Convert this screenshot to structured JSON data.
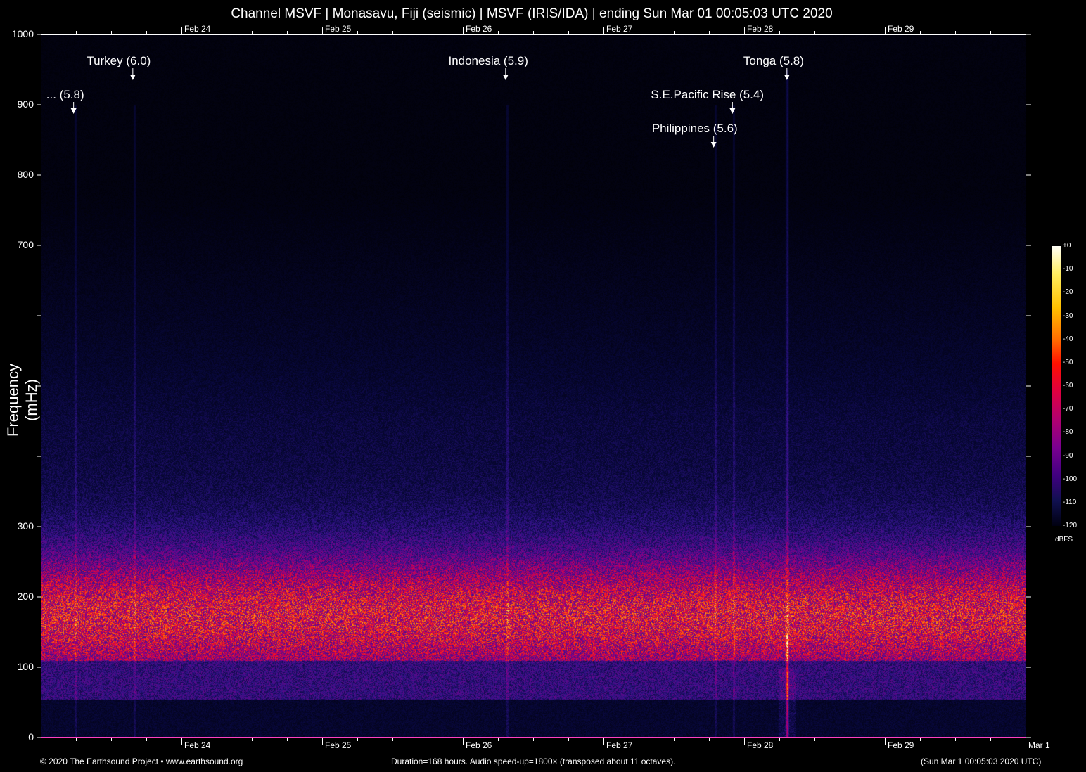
{
  "title": "Channel MSVF | Monasavu, Fiji (seismic) | MSVF (IRIS/IDA) | ending Sun Mar 01 00:05:03 UTC 2020",
  "chart_data": {
    "type": "heatmap",
    "title": "Channel MSVF | Monasavu, Fiji (seismic) | MSVF (IRIS/IDA) | ending Sun Mar 01 00:05:03 UTC 2020",
    "ylabel": "Frequency (mHz)",
    "ylim": [
      0,
      1000
    ],
    "y_ticks": [
      0,
      100,
      200,
      300,
      400,
      500,
      600,
      700,
      800,
      900,
      1000
    ],
    "y_tick_labels": [
      "0",
      "100",
      "200",
      "300",
      "",
      "",
      "",
      "700",
      "800",
      "900",
      "1000"
    ],
    "x_duration_hours": 168,
    "x_tick_labels": [
      "Feb 24",
      "Feb 25",
      "Feb 26",
      "Feb 27",
      "Feb 28",
      "Feb 29",
      "Mar  1"
    ],
    "x_tick_hours": [
      24,
      48,
      72,
      96,
      120,
      144,
      168
    ],
    "colorbar": {
      "unit": "dBFS",
      "range": [
        -120,
        0
      ],
      "tick_labels": [
        "+0",
        "-10",
        "-20",
        "-30",
        "-40",
        "-50",
        "-60",
        "-70",
        "-80",
        "-90",
        "-100",
        "-110",
        "-120"
      ]
    },
    "events": [
      {
        "label": "... (5.8)",
        "hour": 5.6
      },
      {
        "label": "Turkey (6.0)",
        "hour": 15.7
      },
      {
        "label": "Indonesia (5.9)",
        "hour": 79.3
      },
      {
        "label": "Philippines (5.6)",
        "hour": 114.8
      },
      {
        "label": "S.E.Pacific Rise (5.4)",
        "hour": 118.0
      },
      {
        "label": "Tonga (5.8)",
        "hour": 127.3
      }
    ]
  },
  "footer": {
    "copyright": "© 2020 The Earthsound Project • www.earthsound.org",
    "info": "Duration=168 hours. Audio speed-up=1800× (transposed about 11 octaves).",
    "end_time": "(Sun Mar  1 00:05:03 2020 UTC)"
  }
}
